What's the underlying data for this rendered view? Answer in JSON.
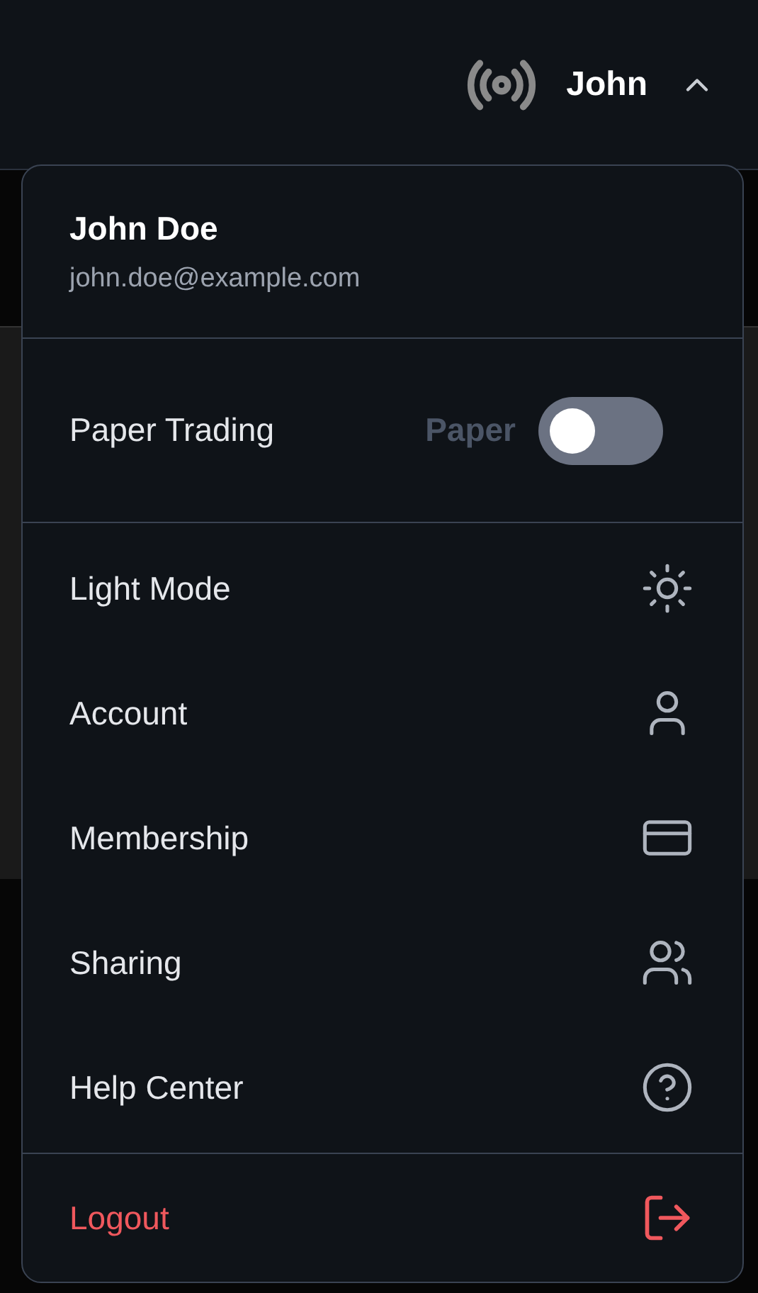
{
  "header": {
    "user_label": "John",
    "menu_expanded": true
  },
  "profile": {
    "name": "John Doe",
    "email": "john.doe@example.com"
  },
  "paper_trading": {
    "label": "Paper Trading",
    "mode_label": "Paper",
    "on": false
  },
  "menu_items": [
    {
      "label": "Light Mode",
      "kind": "normal"
    },
    {
      "label": "Account",
      "kind": "normal"
    },
    {
      "label": "Membership",
      "kind": "normal"
    },
    {
      "label": "Sharing",
      "kind": "normal"
    },
    {
      "label": "Help Center",
      "kind": "normal"
    }
  ],
  "logout": {
    "label": "Logout",
    "kind": "danger"
  }
}
